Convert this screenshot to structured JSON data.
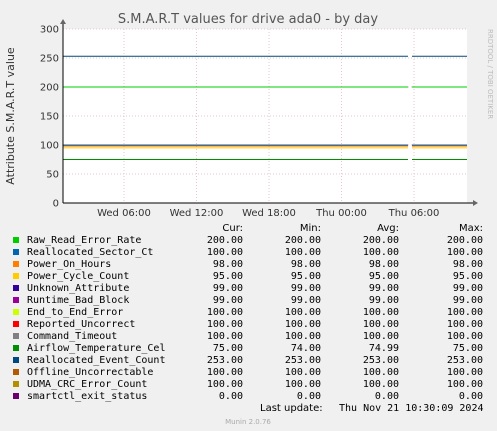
{
  "side_label": "RRDTOOL / TOBI OETIKER",
  "footer": "Munin 2.0.76",
  "last_update_label": "Last update:",
  "last_update_value": "Thu Nov 21 10:30:09 2024",
  "chart_data": {
    "type": "line",
    "title": "S.M.A.R.T values for drive ada0 - by day",
    "xlabel": "",
    "ylabel": "Attribute S.M.A.R.T value",
    "ylim": [
      0,
      300
    ],
    "yticks": [
      0,
      50,
      100,
      150,
      200,
      250,
      300
    ],
    "xticks": [
      "Wed 06:00",
      "Wed 12:00",
      "Wed 18:00",
      "Thu 00:00",
      "Thu 06:00"
    ],
    "grid": true,
    "legend_headers": [
      "Cur:",
      "Min:",
      "Avg:",
      "Max:"
    ],
    "series": [
      {
        "name": "Raw_Read_Error_Rate",
        "color": "#00cc00",
        "cur": "200.00",
        "min": "200.00",
        "avg": "200.00",
        "max": "200.00",
        "value": 200
      },
      {
        "name": "Reallocated_Sector_Ct",
        "color": "#0066b3",
        "cur": "100.00",
        "min": "100.00",
        "avg": "100.00",
        "max": "100.00",
        "value": 100
      },
      {
        "name": "Power_On_Hours",
        "color": "#ff8000",
        "cur": "98.00",
        "min": "98.00",
        "avg": "98.00",
        "max": "98.00",
        "value": 98
      },
      {
        "name": "Power_Cycle_Count",
        "color": "#ffcc00",
        "cur": "95.00",
        "min": "95.00",
        "avg": "95.00",
        "max": "95.00",
        "value": 95
      },
      {
        "name": "Unknown_Attribute",
        "color": "#330099",
        "cur": "99.00",
        "min": "99.00",
        "avg": "99.00",
        "max": "99.00",
        "value": 99
      },
      {
        "name": "Runtime_Bad_Block",
        "color": "#990099",
        "cur": "99.00",
        "min": "99.00",
        "avg": "99.00",
        "max": "99.00",
        "value": 99
      },
      {
        "name": "End_to_End_Error",
        "color": "#ccff00",
        "cur": "100.00",
        "min": "100.00",
        "avg": "100.00",
        "max": "100.00",
        "value": 100
      },
      {
        "name": "Reported_Uncorrect",
        "color": "#ff0000",
        "cur": "100.00",
        "min": "100.00",
        "avg": "100.00",
        "max": "100.00",
        "value": 100
      },
      {
        "name": "Command_Timeout",
        "color": "#808080",
        "cur": "100.00",
        "min": "100.00",
        "avg": "100.00",
        "max": "100.00",
        "value": 100
      },
      {
        "name": "Airflow_Temperature_Cel",
        "color": "#008f00",
        "cur": "75.00",
        "min": "74.00",
        "avg": "74.99",
        "max": "75.00",
        "value": 75
      },
      {
        "name": "Reallocated_Event_Count",
        "color": "#00487d",
        "cur": "253.00",
        "min": "253.00",
        "avg": "253.00",
        "max": "253.00",
        "value": 253
      },
      {
        "name": "Offline_Uncorrectable",
        "color": "#b35a00",
        "cur": "100.00",
        "min": "100.00",
        "avg": "100.00",
        "max": "100.00",
        "value": 100
      },
      {
        "name": "UDMA_CRC_Error_Count",
        "color": "#b38f00",
        "cur": "100.00",
        "min": "100.00",
        "avg": "100.00",
        "max": "100.00",
        "value": 100
      },
      {
        "name": "smartctl_exit_status",
        "color": "#6b006b",
        "cur": "0.00",
        "min": "0.00",
        "avg": "0.00",
        "max": "0.00",
        "value": 0
      }
    ]
  }
}
